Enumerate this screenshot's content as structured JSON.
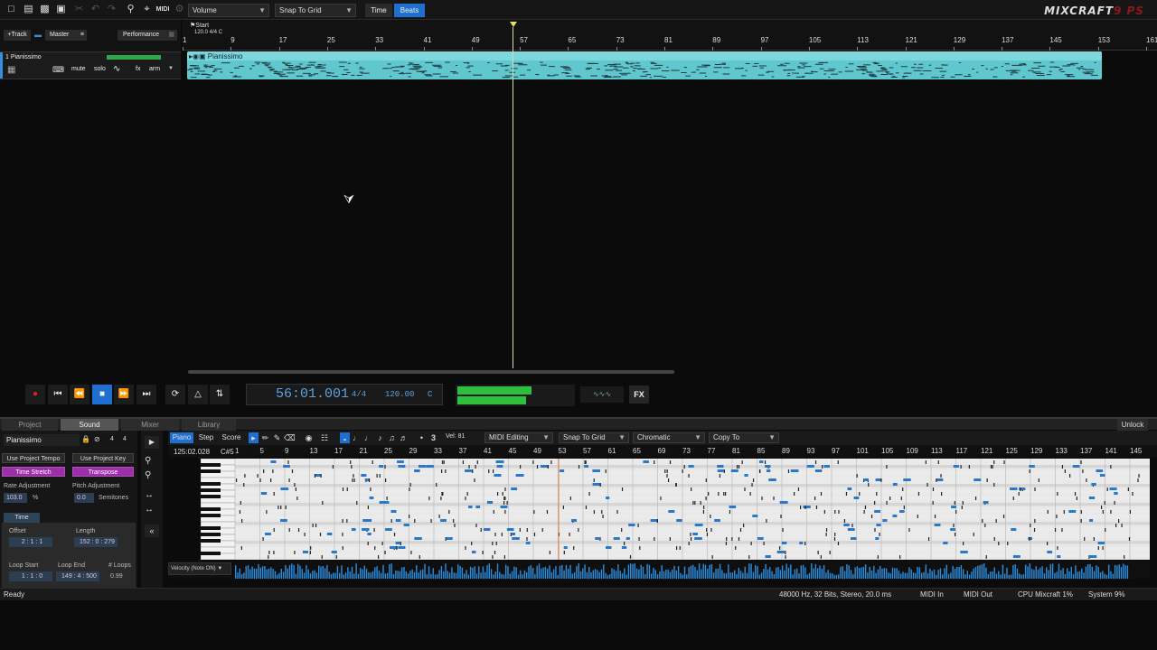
{
  "toolbar": {
    "volume_dropdown": "Volume",
    "snap_dropdown": "Snap To Grid",
    "time_btn": "Time",
    "beats_btn": "Beats",
    "logo": "MIXCRAFT",
    "logo_suffix": "9 PS"
  },
  "track_header": {
    "add_track": "+Track",
    "master": "Master",
    "performance": "Performance"
  },
  "ruler": {
    "start_label": "Start",
    "tempo_key": "120.0 4/4 C",
    "ticks": [
      "1",
      "9",
      "17",
      "25",
      "33",
      "41",
      "49",
      "57",
      "65",
      "73",
      "81",
      "89",
      "97",
      "105",
      "113",
      "121",
      "129",
      "137",
      "145",
      "153",
      "161"
    ]
  },
  "track": {
    "name": "1 Pianissimo",
    "mute": "mute",
    "solo": "solo",
    "fx": "fx",
    "arm": "arm",
    "clip_name": "Pianissimo"
  },
  "transport": {
    "time": "56:01.001",
    "time_sig": "4/4",
    "tempo": "120.00",
    "key": "C",
    "fx": "FX"
  },
  "bottom_tabs": [
    "Project",
    "Sound",
    "Mixer",
    "Library"
  ],
  "bottom_right": "Unlock",
  "left_panel": {
    "clip_name": "Pianissimo",
    "meter_num": "4",
    "meter_den": "4",
    "use_project_tempo": "Use Project Tempo",
    "use_project_key": "Use Project Key",
    "time_stretch": "Time Stretch",
    "transpose": "Transpose",
    "rate_adjustment_label": "Rate Adjustment",
    "rate_value": "103.0",
    "rate_unit": "%",
    "pitch_adjustment_label": "Pitch Adjustment",
    "pitch_value": "0.0",
    "pitch_unit": "Semitones",
    "time_tab": "Time",
    "offset_label": "Offset",
    "offset_value": "2 : 1 : 1",
    "length_label": "Length",
    "length_value": "152 : 0 : 279",
    "loop_start_label": "Loop Start",
    "loop_start_value": "1 : 1 : 0",
    "loop_end_label": "Loop End",
    "loop_end_value": "149 : 4 : 500",
    "loops_label": "# Loops",
    "loops_value": "0.99"
  },
  "piano_roll": {
    "tab_piano": "Piano",
    "tab_step": "Step",
    "tab_score": "Score",
    "velocity": "Vel: 81",
    "midi_editing": "MIDI Editing",
    "snap": "Snap To Grid",
    "scale": "Chromatic",
    "copy_to": "Copy To",
    "position": "125:02.028",
    "note": "C#5",
    "ticks": [
      "1",
      "5",
      "9",
      "13",
      "17",
      "21",
      "25",
      "29",
      "33",
      "37",
      "41",
      "45",
      "49",
      "53",
      "57",
      "61",
      "65",
      "69",
      "73",
      "77",
      "81",
      "85",
      "89",
      "93",
      "97",
      "101",
      "105",
      "109",
      "113",
      "117",
      "121",
      "125",
      "129",
      "133",
      "137",
      "141",
      "145"
    ],
    "velocity_lane": "Velocity (Note ON)"
  },
  "status": {
    "ready": "Ready",
    "audio": "48000 Hz, 32 Bits, Stereo, 20.0 ms",
    "midi_in": "MIDI In",
    "midi_out": "MIDI Out",
    "cpu": "CPU Mixcraft 1%",
    "system": "System 9%"
  }
}
